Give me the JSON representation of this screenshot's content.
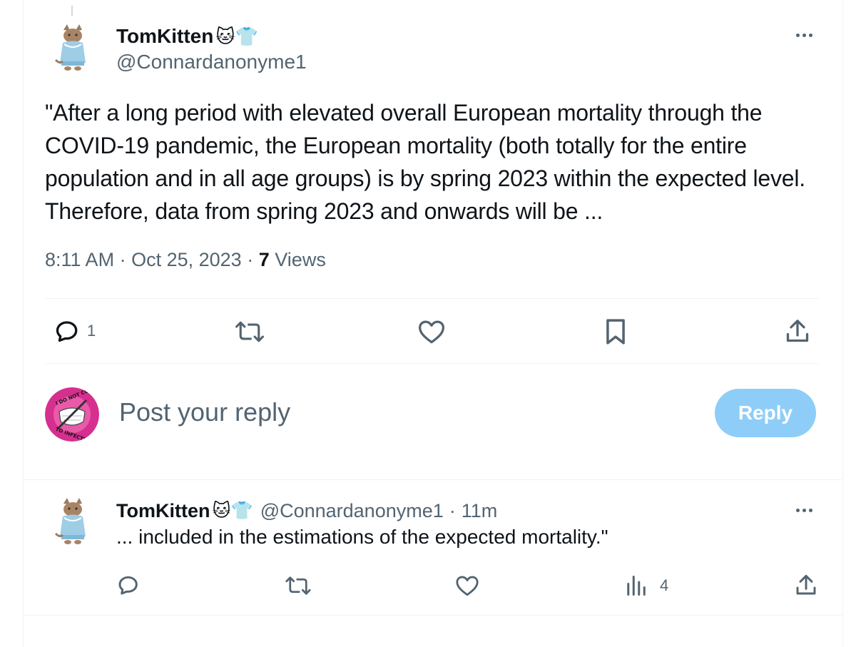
{
  "main_post": {
    "display_name": "TomKitten",
    "emoji": "🐱👕",
    "handle": "@Connardanonyme1",
    "text": "\"After a long period with elevated overall European mortality through the COVID-19 pandemic, the European mortality (both totally for the entire population and in all age groups) is by spring 2023 within the expected level. Therefore, data from spring 2023 and onwards will be ...",
    "time": "8:11 AM",
    "date": "Oct 25, 2023",
    "views_count": "7",
    "views_label": "Views",
    "separator": "·",
    "reply_count": "1"
  },
  "composer": {
    "placeholder": "Post your reply",
    "avatar_text_top": "I DO NOT CONSENT",
    "avatar_text_bottom": "TO INFECTION",
    "reply_button": "Reply"
  },
  "reply_post": {
    "display_name": "TomKitten",
    "emoji": "🐱👕",
    "handle": "@Connardanonyme1",
    "separator": "·",
    "time_ago": "11m",
    "text": "... included in the estimations of the expected mortality.\"",
    "views_count": "4"
  },
  "icons": {
    "reply": "reply-icon",
    "repost": "repost-icon",
    "like": "like-icon",
    "bookmark": "bookmark-icon",
    "share": "share-icon",
    "analytics": "analytics-icon",
    "more": "more-icon"
  },
  "colors": {
    "text": "#0f1419",
    "secondary": "#536471",
    "reply_button": "#8ecdf8",
    "composer_avatar": "#d52f8f"
  }
}
